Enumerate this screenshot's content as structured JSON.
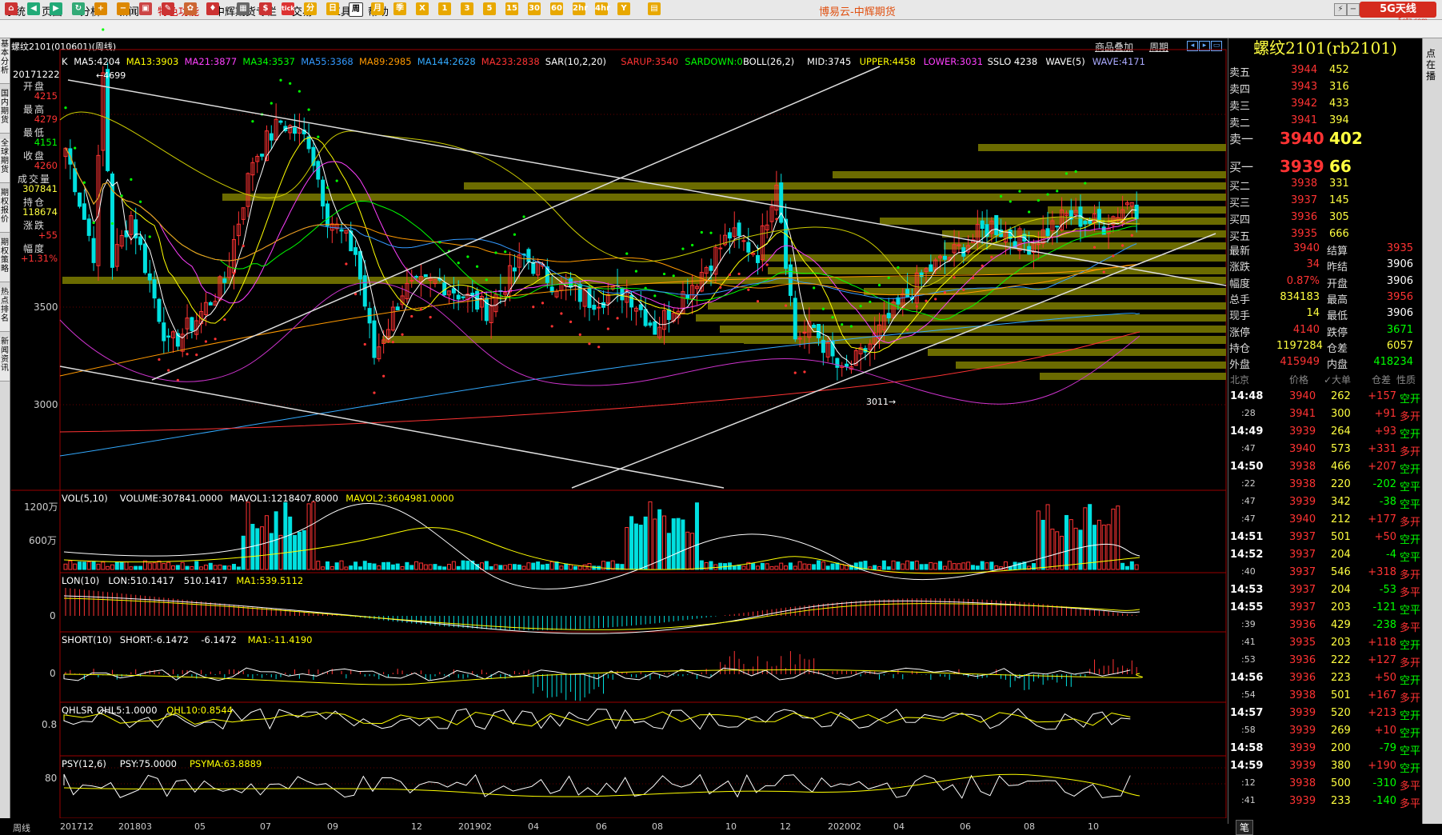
{
  "menu": {
    "items": [
      "系统",
      "页面",
      "分析",
      "新闻",
      "特色功能",
      "中辉期货专栏",
      "交易",
      "工具",
      "帮助"
    ],
    "special_index": 4,
    "app_title": "博易云-中辉期货",
    "logo_text": "5G天线",
    "logo_sub": "5etz.com"
  },
  "toolbar": {
    "buttons": [
      "home-icon",
      "back-icon",
      "forward-icon",
      "refresh-icon",
      "zoom-in-icon",
      "zoom-out-icon",
      "window-icon",
      "draw-icon",
      "paint-icon",
      "indicator-icon",
      "table-icon",
      "buy-sell-icon",
      "tick",
      "分",
      "日",
      "周",
      "月",
      "季",
      "X",
      "1",
      "3",
      "5",
      "15",
      "30",
      "60",
      "2hr",
      "4hr",
      "Y",
      "calendar-icon"
    ]
  },
  "chart": {
    "title": "螺纹2101(010601)(周线)",
    "links": [
      "商品叠加",
      "周期"
    ],
    "sidebar_tabs": [
      "基本分析",
      "国内期货",
      "全球期货",
      "期权报价",
      "期权策略",
      "热点排名",
      "新闻资讯"
    ],
    "ma_legend": [
      {
        "text": "K",
        "color": "#ffffff"
      },
      {
        "text": "MA5:4204",
        "color": "#ffffff"
      },
      {
        "text": "MA13:3903",
        "color": "#ffff00"
      },
      {
        "text": "MA21:3877",
        "color": "#ff40ff"
      },
      {
        "text": "MA34:3537",
        "color": "#00ff00"
      },
      {
        "text": "MA55:3368",
        "color": "#3399ff"
      },
      {
        "text": "MA89:2985",
        "color": "#ff9900"
      },
      {
        "text": "MA144:2628",
        "color": "#33aaff"
      },
      {
        "text": "MA233:2838",
        "color": "#ff3333"
      },
      {
        "text": "SAR(10,2,20)",
        "color": "#ffffff"
      },
      {
        "text": "SARUP:3540",
        "color": "#ff3333"
      },
      {
        "text": "SARDOWN:0",
        "color": "#00ff00"
      },
      {
        "text": "BOLL(26,2)",
        "color": "#ffffff"
      },
      {
        "text": "MID:3745",
        "color": "#ffffff"
      },
      {
        "text": "UPPER:4458",
        "color": "#ffff00"
      },
      {
        "text": "LOWER:3031",
        "color": "#ff40ff"
      },
      {
        "text": "SSLO 4238",
        "color": "#ffffff"
      },
      {
        "text": "WAVE(5)",
        "color": "#ffffff"
      },
      {
        "text": "WAVE:4171",
        "color": "#aaaaff"
      }
    ],
    "y_labels": [
      "3500",
      "3000"
    ],
    "high_marker": "4699",
    "low_marker": "3011",
    "info": {
      "date": "20171222",
      "rows": [
        {
          "label": "开盘",
          "value": "4215",
          "color": "#ff3333"
        },
        {
          "label": "最高",
          "value": "4279",
          "color": "#ff3333"
        },
        {
          "label": "最低",
          "value": "4151",
          "color": "#00ff00"
        },
        {
          "label": "收盘",
          "value": "4260",
          "color": "#ff3333"
        },
        {
          "label": "成交量",
          "value": "307841",
          "color": "#ffff40"
        },
        {
          "label": "持仓",
          "value": "118674",
          "color": "#ffff40"
        },
        {
          "label": "涨跌",
          "value": "+55",
          "color": "#ff3333"
        },
        {
          "label": "幅度",
          "value": "+1.31%",
          "color": "#ff3333"
        }
      ]
    },
    "x_labels": [
      "周线",
      "201712",
      "201803",
      "05",
      "07",
      "09",
      "12",
      "201902",
      "04",
      "06",
      "08",
      "10",
      "12",
      "202002",
      "04",
      "06",
      "08",
      "10"
    ]
  },
  "indicators": [
    {
      "id": "vol",
      "legend": [
        {
          "text": "VOL(5,10)",
          "color": "#ffffff"
        },
        {
          "text": "VOLUME:307841.0000",
          "color": "#ffffff"
        },
        {
          "text": "MAVOL1:1218407.8000",
          "color": "#ffffff"
        },
        {
          "text": "MAVOL2:3604981.0000",
          "color": "#ffff00"
        }
      ],
      "y_labels": [
        "1200万",
        "600万"
      ]
    },
    {
      "id": "lon",
      "legend": [
        {
          "text": "LON(10)",
          "color": "#ffffff"
        },
        {
          "text": "LON:510.1417",
          "color": "#ffffff"
        },
        {
          "text": "510.1417",
          "color": "#ffffff"
        },
        {
          "text": "MA1:539.5112",
          "color": "#ffff00"
        }
      ],
      "y_labels": [
        "0"
      ]
    },
    {
      "id": "short",
      "legend": [
        {
          "text": "SHORT(10)",
          "color": "#ffffff"
        },
        {
          "text": "SHORT:-6.1472",
          "color": "#ffffff"
        },
        {
          "text": "-6.1472",
          "color": "#ffffff"
        },
        {
          "text": "MA1:-11.4190",
          "color": "#ffff00"
        }
      ],
      "y_labels": [
        "0"
      ]
    },
    {
      "id": "qhlsr",
      "legend": [
        {
          "text": "QHLSR",
          "color": "#ffffff"
        },
        {
          "text": "QHL5:1.0000",
          "color": "#ffffff"
        },
        {
          "text": "QHL10:0.8544",
          "color": "#ffff00"
        }
      ],
      "y_labels": [
        "0.8"
      ]
    },
    {
      "id": "psy",
      "legend": [
        {
          "text": "PSY(12,6)",
          "color": "#ffffff"
        },
        {
          "text": "PSY:75.0000",
          "color": "#ffffff"
        },
        {
          "text": "PSYMA:63.8889",
          "color": "#ffff00"
        }
      ],
      "y_labels": [
        "80"
      ]
    }
  ],
  "quote": {
    "title": "螺纹2101(rb2101)",
    "asks": [
      {
        "label": "卖五",
        "price": "3944",
        "vol": "452"
      },
      {
        "label": "卖四",
        "price": "3943",
        "vol": "316"
      },
      {
        "label": "卖三",
        "price": "3942",
        "vol": "433"
      },
      {
        "label": "卖二",
        "price": "3941",
        "vol": "394"
      },
      {
        "label": "卖一",
        "price": "3940",
        "vol": "402"
      }
    ],
    "bids": [
      {
        "label": "买一",
        "price": "3939",
        "vol": "66"
      },
      {
        "label": "买二",
        "price": "3938",
        "vol": "331"
      },
      {
        "label": "买三",
        "price": "3937",
        "vol": "145"
      },
      {
        "label": "买四",
        "price": "3936",
        "vol": "305"
      },
      {
        "label": "买五",
        "price": "3935",
        "vol": "666"
      }
    ],
    "stats": [
      {
        "l1": "最新",
        "v1": "3940",
        "c1": "#ff3333",
        "l2": "结算",
        "v2": "3935",
        "c2": "#ff3333"
      },
      {
        "l1": "涨跌",
        "v1": "34",
        "c1": "#ff3333",
        "l2": "昨结",
        "v2": "3906",
        "c2": "#ffffff"
      },
      {
        "l1": "幅度",
        "v1": "0.87%",
        "c1": "#ff3333",
        "l2": "开盘",
        "v2": "3906",
        "c2": "#ffffff"
      },
      {
        "l1": "总手",
        "v1": "834183",
        "c1": "#ffff40",
        "l2": "最高",
        "v2": "3956",
        "c2": "#ff3333"
      },
      {
        "l1": "现手",
        "v1": "14",
        "c1": "#ffff40",
        "l2": "最低",
        "v2": "3906",
        "c2": "#ffffff"
      },
      {
        "l1": "涨停",
        "v1": "4140",
        "c1": "#ff3333",
        "l2": "跌停",
        "v2": "3671",
        "c2": "#00ff00"
      },
      {
        "l1": "持仓",
        "v1": "1197284",
        "c1": "#ffff40",
        "l2": "仓差",
        "v2": "6057",
        "c2": "#ffff40"
      },
      {
        "l1": "外盘",
        "v1": "415949",
        "c1": "#ff3333",
        "l2": "内盘",
        "v2": "418234",
        "c2": "#00ff00"
      }
    ],
    "tick_headers": [
      "北京",
      "价格",
      "✓大单",
      "仓差",
      "性质"
    ],
    "ticks": [
      {
        "time": "14:48",
        "price": "3940",
        "vol": "262",
        "chg": "+157",
        "type": "空开"
      },
      {
        "time": ":28",
        "price": "3941",
        "vol": "300",
        "chg": "+91",
        "type": "多开"
      },
      {
        "time": "14:49",
        "price": "3939",
        "vol": "264",
        "chg": "+93",
        "type": "空开"
      },
      {
        "time": ":47",
        "price": "3940",
        "vol": "573",
        "chg": "+331",
        "type": "多开"
      },
      {
        "time": "14:50",
        "price": "3938",
        "vol": "466",
        "chg": "+207",
        "type": "空开"
      },
      {
        "time": ":22",
        "price": "3938",
        "vol": "220",
        "chg": "-202",
        "type": "空平"
      },
      {
        "time": ":47",
        "price": "3939",
        "vol": "342",
        "chg": "-38",
        "type": "空平"
      },
      {
        "time": ":47",
        "price": "3940",
        "vol": "212",
        "chg": "+177",
        "type": "多开"
      },
      {
        "time": "14:51",
        "price": "3937",
        "vol": "501",
        "chg": "+50",
        "type": "空开"
      },
      {
        "time": "14:52",
        "price": "3937",
        "vol": "204",
        "chg": "-4",
        "type": "空平"
      },
      {
        "time": ":40",
        "price": "3937",
        "vol": "546",
        "chg": "+318",
        "type": "多开"
      },
      {
        "time": "14:53",
        "price": "3937",
        "vol": "204",
        "chg": "-53",
        "type": "多平"
      },
      {
        "time": "14:55",
        "price": "3937",
        "vol": "203",
        "chg": "-121",
        "type": "空平"
      },
      {
        "time": ":39",
        "price": "3936",
        "vol": "429",
        "chg": "-238",
        "type": "多平"
      },
      {
        "time": ":41",
        "price": "3935",
        "vol": "203",
        "chg": "+118",
        "type": "空开"
      },
      {
        "time": ":53",
        "price": "3936",
        "vol": "222",
        "chg": "+127",
        "type": "多开"
      },
      {
        "time": "14:56",
        "price": "3936",
        "vol": "223",
        "chg": "+50",
        "type": "空开"
      },
      {
        "time": ":54",
        "price": "3938",
        "vol": "501",
        "chg": "+167",
        "type": "多开"
      },
      {
        "time": "14:57",
        "price": "3939",
        "vol": "520",
        "chg": "+213",
        "type": "空开"
      },
      {
        "time": ":58",
        "price": "3939",
        "vol": "269",
        "chg": "+10",
        "type": "空开"
      },
      {
        "time": "14:58",
        "price": "3939",
        "vol": "200",
        "chg": "-79",
        "type": "空平"
      },
      {
        "time": "14:59",
        "price": "3939",
        "vol": "380",
        "chg": "+190",
        "type": "空开"
      },
      {
        "time": ":12",
        "price": "3938",
        "vol": "500",
        "chg": "-310",
        "type": "多平"
      },
      {
        "time": ":41",
        "price": "3939",
        "vol": "233",
        "chg": "-140",
        "type": "多平"
      }
    ],
    "bottom_tab": "笔",
    "right_tab": "点在播"
  }
}
